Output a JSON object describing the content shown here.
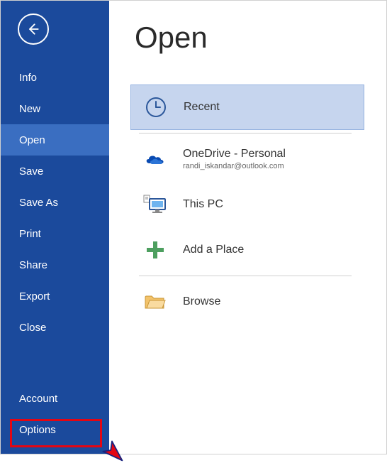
{
  "sidebar": {
    "items": [
      {
        "label": "Info"
      },
      {
        "label": "New"
      },
      {
        "label": "Open",
        "selected": true
      },
      {
        "label": "Save"
      },
      {
        "label": "Save As"
      },
      {
        "label": "Print"
      },
      {
        "label": "Share"
      },
      {
        "label": "Export"
      },
      {
        "label": "Close"
      }
    ],
    "bottom": [
      {
        "label": "Account"
      },
      {
        "label": "Options"
      }
    ]
  },
  "main": {
    "title": "Open",
    "locations": [
      {
        "label": "Recent",
        "selected": true
      },
      {
        "label": "OneDrive - Personal",
        "sub": "randi_iskandar@outlook.com"
      },
      {
        "label": "This PC"
      },
      {
        "label": "Add a Place"
      },
      {
        "label": "Browse"
      }
    ]
  },
  "annotation": {
    "highlighted_item": "Options"
  }
}
